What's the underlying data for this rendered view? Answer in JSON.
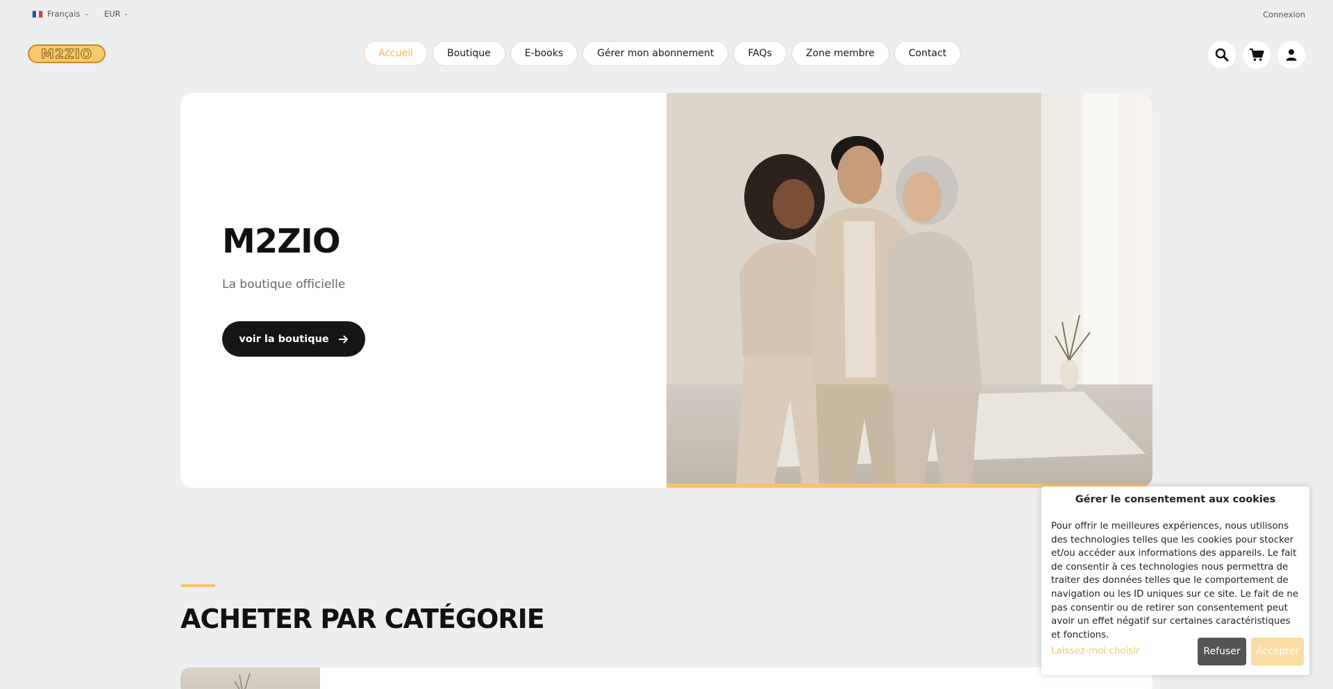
{
  "topbar": {
    "language": "Français",
    "currency": "EUR",
    "login": "Connexion"
  },
  "header": {
    "logo_text": "M2ZIO",
    "nav": [
      {
        "label": "Accueil",
        "active": true
      },
      {
        "label": "Boutique"
      },
      {
        "label": "E-books"
      },
      {
        "label": "Gérer mon abonnement"
      },
      {
        "label": "FAQs"
      },
      {
        "label": "Zone membre"
      },
      {
        "label": "Contact"
      }
    ],
    "icons": [
      "search-icon",
      "cart-icon",
      "user-icon"
    ]
  },
  "hero": {
    "title": "M2ZIO",
    "subtitle": "La boutique officielle",
    "button": "voir la boutique"
  },
  "section": {
    "title": "ACHETER PAR CATÉGORIE"
  },
  "cookie": {
    "title": "Gérer le consentement aux cookies",
    "text": "Pour offrir le meilleures expériences, nous utilisons des technologies telles que les cookies pour stocker et/ou accéder aux informations des appareils. Le fait de consentir à ces technologies nous permettra de traiter des données telles que le comportement de navigation ou les ID uniques sur ce site. Le fait de ne pas consentir ou de retirer son consentement peut avoir un effet négatif sur certaines caractéristiques et fonctions.",
    "choose": "Laissez-moi choisir",
    "refuse": "Refuser",
    "accept": "Accepter"
  },
  "colors": {
    "accent": "#f5c46a",
    "dark": "#151515",
    "background": "#eceef0"
  }
}
